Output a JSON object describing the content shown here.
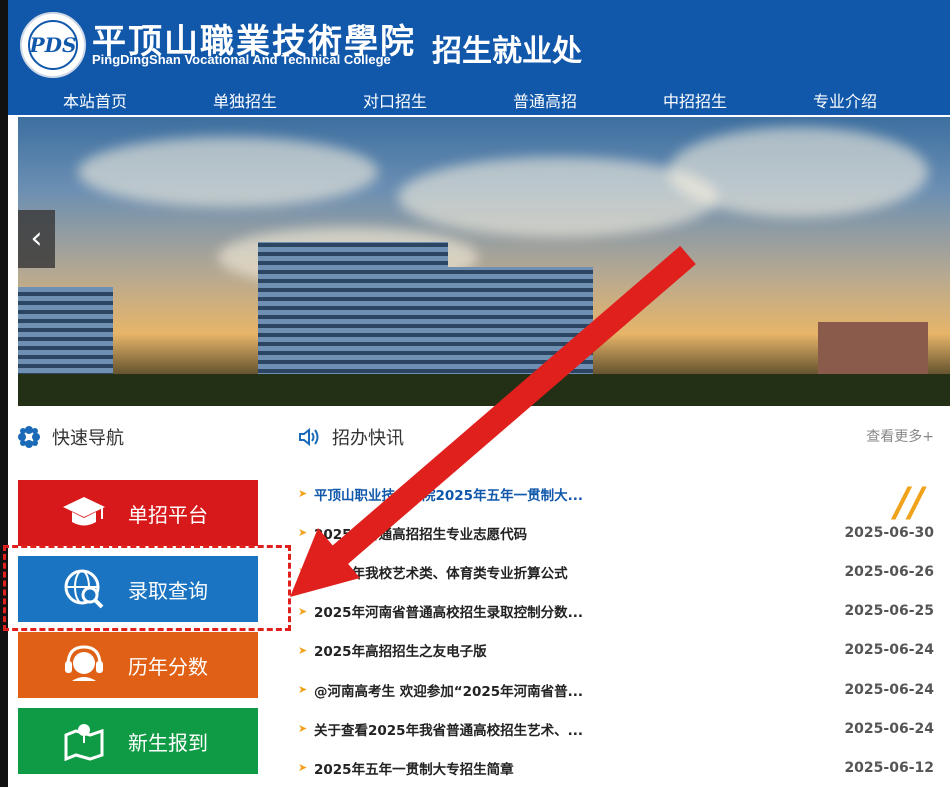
{
  "header": {
    "college_name_cn": "平顶山職業技術學院",
    "college_name_en": "PingDingShan Vocational And Technical College",
    "office_title": "招生就业处",
    "logo_label": "PDS"
  },
  "nav": [
    {
      "label": "本站首页"
    },
    {
      "label": "单独招生"
    },
    {
      "label": "对口招生"
    },
    {
      "label": "普通高招"
    },
    {
      "label": "中招招生"
    },
    {
      "label": "专业介绍"
    }
  ],
  "banner": {
    "prev_symbol": "‹"
  },
  "quick_nav": {
    "title": "快速导航",
    "buttons": [
      {
        "label": "单招平台",
        "icon": "graduation-cap-icon",
        "color": "#d7191b"
      },
      {
        "label": "录取查询",
        "icon": "globe-search-icon",
        "color": "#1a74c2"
      },
      {
        "label": "历年分数",
        "icon": "headset-icon",
        "color": "#e06116"
      },
      {
        "label": "新生报到",
        "icon": "map-icon",
        "color": "#0f9b45"
      }
    ]
  },
  "news": {
    "title": "招办快讯",
    "more_label": "查看更多+",
    "items": [
      {
        "title": "平顶山职业技术学院2025年五年一贯制大...",
        "date": ""
      },
      {
        "title": "2025年普通高招招生专业志愿代码",
        "date": "2025-06-30"
      },
      {
        "title": "2025年我校艺术类、体育类专业折算公式",
        "date": "2025-06-26"
      },
      {
        "title": "2025年河南省普通高校招生录取控制分数...",
        "date": "2025-06-25"
      },
      {
        "title": "2025年高招招生之友电子版",
        "date": "2025-06-24"
      },
      {
        "title": "@河南高考生 欢迎参加“2025年河南省普...",
        "date": "2025-06-24"
      },
      {
        "title": "关于查看2025年我省普通高校招生艺术、...",
        "date": "2025-06-24"
      },
      {
        "title": "2025年五年一贯制大专招生简章",
        "date": "2025-06-12"
      }
    ]
  },
  "colors": {
    "header_blue": "#1158ab",
    "accent_orange": "#f0a21a",
    "highlight_red": "#e0201c"
  }
}
